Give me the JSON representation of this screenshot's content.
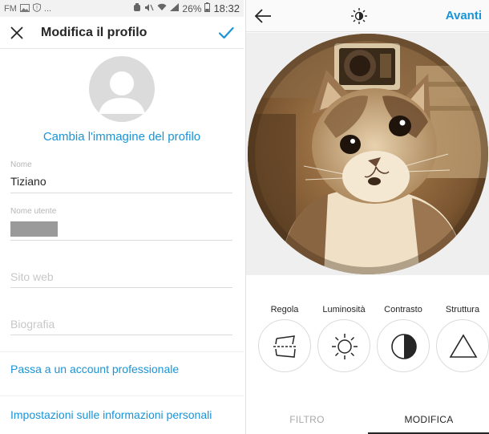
{
  "status_bar": {
    "carrier": "FM",
    "ellipsis": "...",
    "battery_percent": "26%",
    "time": "18:32"
  },
  "edit_profile": {
    "title": "Modifica il profilo",
    "change_photo": "Cambia l'immagine del profilo",
    "fields": {
      "name_label": "Nome",
      "name_value": "Tiziano",
      "username_label": "Nome utente",
      "website_placeholder": "Sito web",
      "bio_placeholder": "Biografia"
    },
    "links": {
      "professional": "Passa a un account professionale",
      "personal": "Impostazioni sulle informazioni personali"
    }
  },
  "photo_editor": {
    "next": "Avanti",
    "tools": [
      {
        "label": "Regola",
        "icon": "adjust-icon"
      },
      {
        "label": "Luminosità",
        "icon": "sun-icon"
      },
      {
        "label": "Contrasto",
        "icon": "contrast-icon"
      },
      {
        "label": "Struttura",
        "icon": "triangle-icon"
      }
    ],
    "tabs": {
      "filter": "FILTRO",
      "edit": "MODIFICA"
    },
    "active_tab": "edit"
  },
  "colors": {
    "accent": "#1a94d6",
    "text": "#262626",
    "muted": "#a8a8a8",
    "divider": "#dbdbdb"
  }
}
